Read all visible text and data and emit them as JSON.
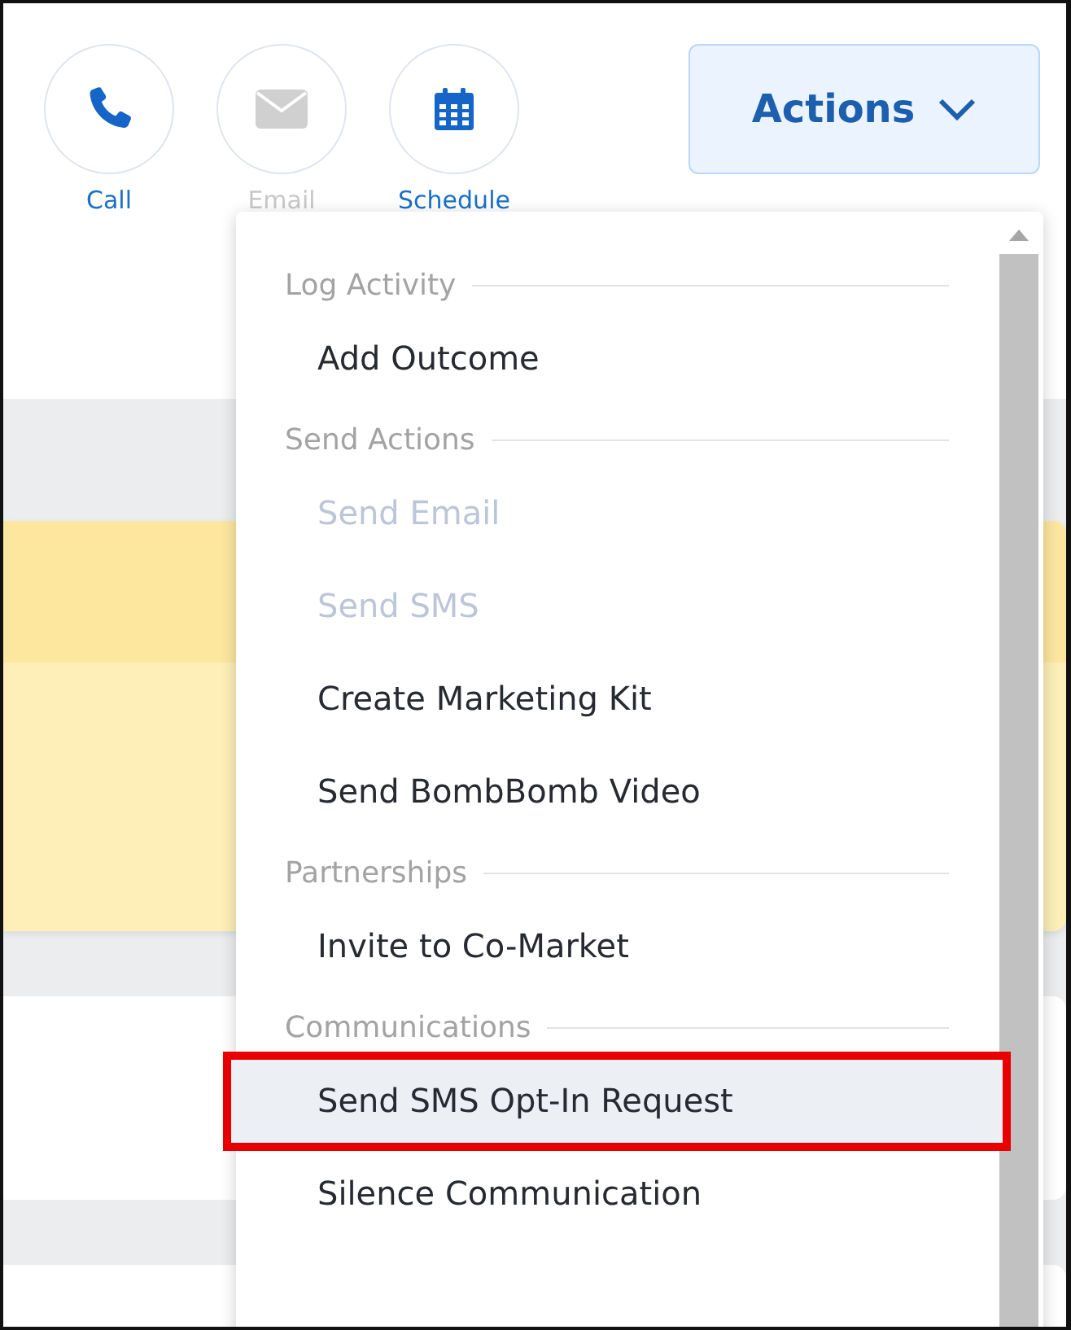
{
  "quick_actions": [
    {
      "kind": "phone",
      "label": "Call",
      "disabled": false
    },
    {
      "kind": "email",
      "label": "Email",
      "disabled": true
    },
    {
      "kind": "calendar",
      "label": "Schedule",
      "disabled": false
    }
  ],
  "actions_button": {
    "label": "Actions",
    "expanded": true
  },
  "menu": [
    {
      "kind": "header",
      "label": "Log Activity"
    },
    {
      "kind": "item",
      "label": "Add Outcome",
      "disabled": false,
      "selected": false,
      "outlined": false
    },
    {
      "kind": "header",
      "label": "Send Actions"
    },
    {
      "kind": "item",
      "label": "Send Email",
      "disabled": true,
      "selected": false,
      "outlined": false
    },
    {
      "kind": "item",
      "label": "Send SMS",
      "disabled": true,
      "selected": false,
      "outlined": false
    },
    {
      "kind": "item",
      "label": "Create Marketing Kit",
      "disabled": false,
      "selected": false,
      "outlined": false
    },
    {
      "kind": "item",
      "label": "Send BombBomb Video",
      "disabled": false,
      "selected": false,
      "outlined": false
    },
    {
      "kind": "header",
      "label": "Partnerships"
    },
    {
      "kind": "item",
      "label": "Invite to Co-Market",
      "disabled": false,
      "selected": false,
      "outlined": false
    },
    {
      "kind": "header",
      "label": "Communications"
    },
    {
      "kind": "item",
      "label": "Send SMS Opt-In Request",
      "disabled": false,
      "selected": true,
      "outlined": true
    },
    {
      "kind": "item",
      "label": "Silence Communication",
      "disabled": false,
      "selected": false,
      "outlined": false
    }
  ]
}
